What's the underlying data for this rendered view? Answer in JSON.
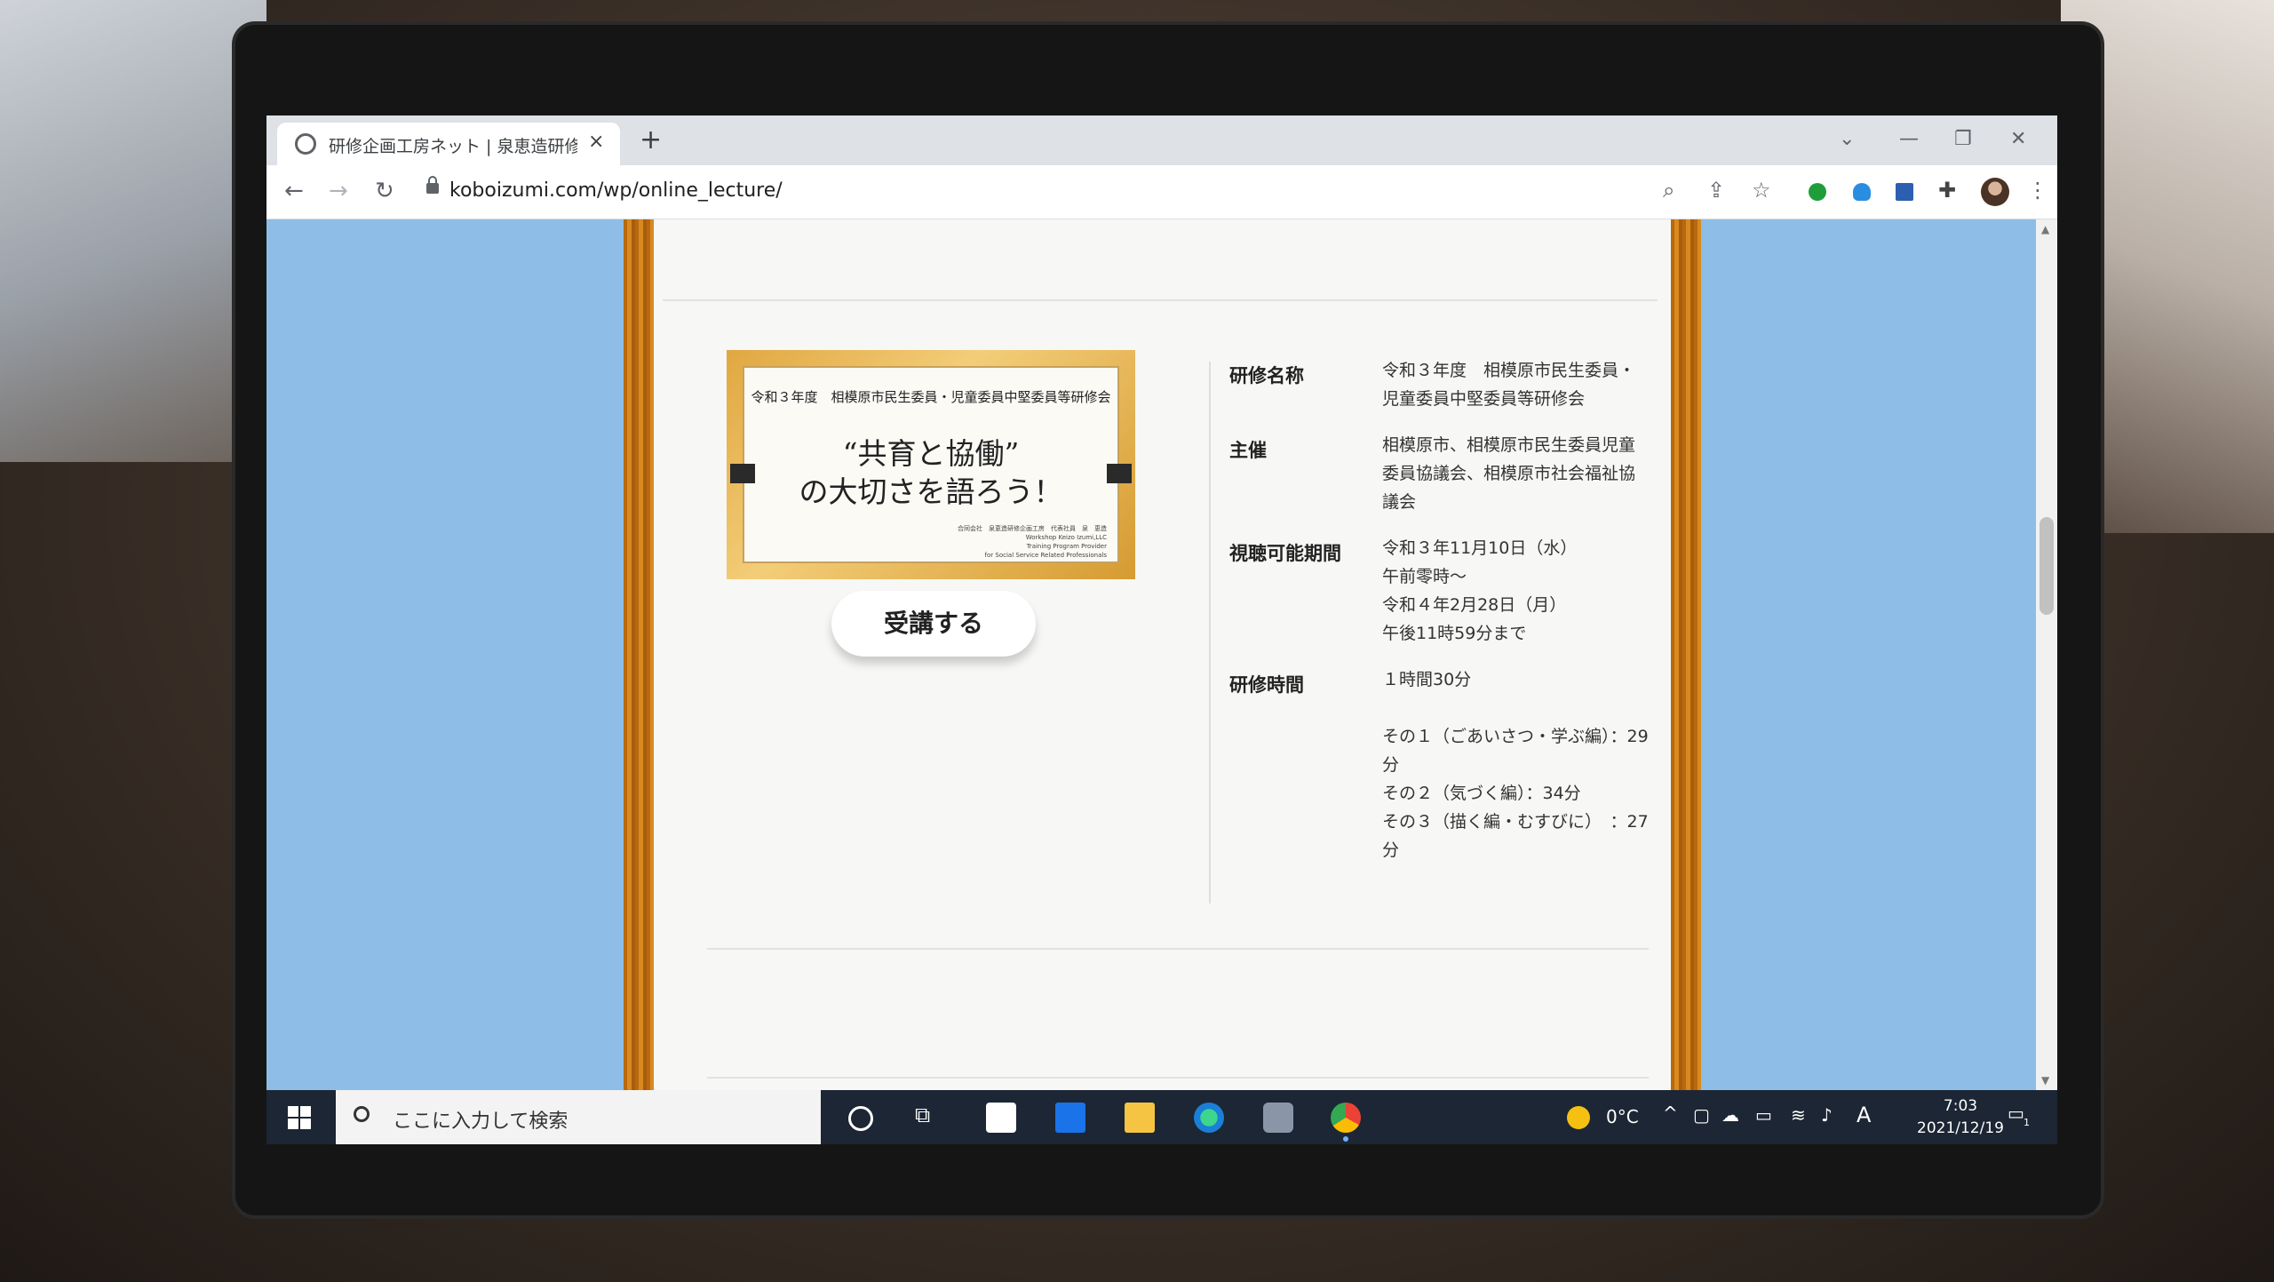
{
  "browser": {
    "tab_title": "研修企画工房ネット | 泉恵造研修企画",
    "tab_close": "×",
    "new_tab": "+",
    "url": "koboizumi.com/wp/online_lecture/"
  },
  "lecture": {
    "image": {
      "subtitle": "令和３年度　相模原市民生委員・児童委員中堅委員等研修会",
      "title_line1": "“共育と協働”",
      "title_line2": "の大切さを語ろう！",
      "fine_print": "合同会社　泉恵造研修企画工房　代表社員　泉　恵造\nWorkshop Keizo Izumi,LLC\nTraining Program Provider\nfor Social Service Related Professionals"
    },
    "attend_button": "受講する",
    "info": [
      {
        "label": "研修名称",
        "value": "令和３年度　相模原市民生委員・児童委員中堅委員等研修会"
      },
      {
        "label": "主催",
        "value": "相模原市、相模原市民生委員児童委員協議会、相模原市社会福祉協議会"
      },
      {
        "label": "視聴可能期間",
        "value": "令和３年11月10日（水）\n午前零時～\n令和４年2月28日（月）\n午後11時59分まで"
      },
      {
        "label": "研修時間",
        "value": "１時間30分\n\nその１（ごあいさつ・学ぶ編）：29分\nその２（気づく編）：34分\nその３（描く編・むすびに）　：27分"
      }
    ]
  },
  "taskbar": {
    "search_placeholder": "ここに入力して検索",
    "weather": "0°C",
    "ime": "A",
    "time": "7:03",
    "date": "2021/12/19",
    "notification_count": "1"
  },
  "colors": {
    "page_background": "#8ebde7",
    "wood_border": "#c8781a",
    "taskbar": "#1c2634"
  }
}
